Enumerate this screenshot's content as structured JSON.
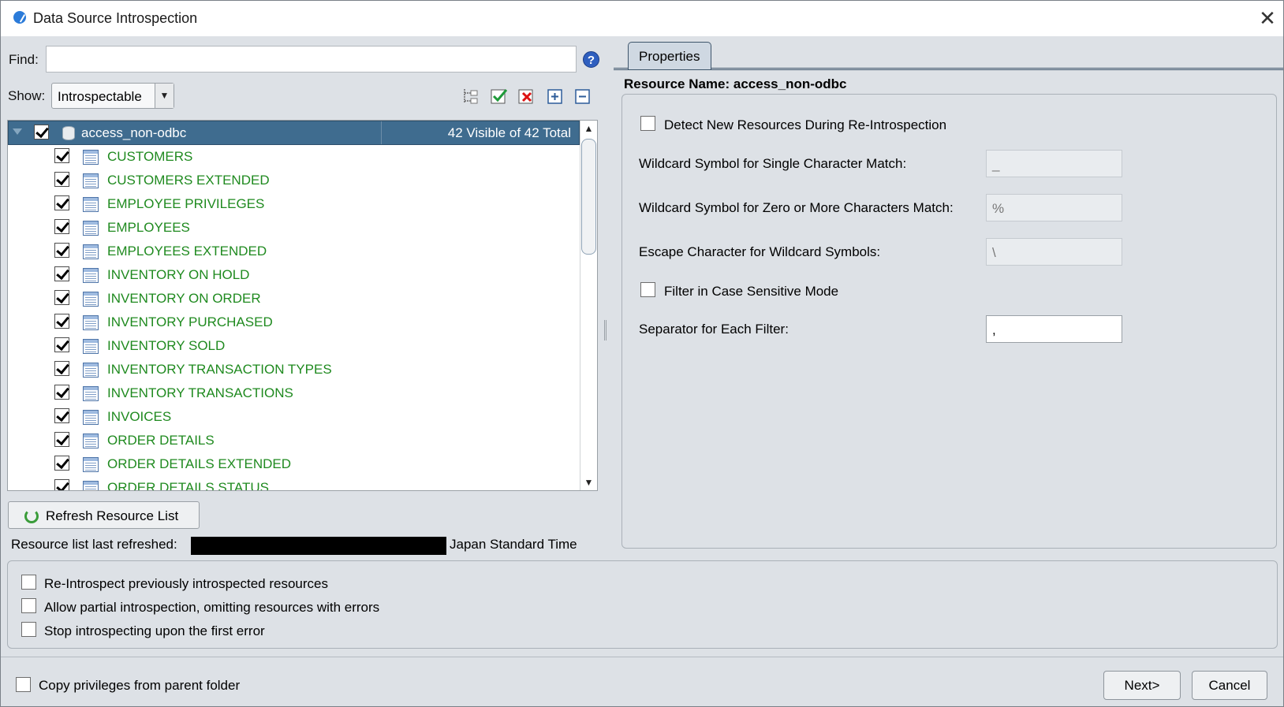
{
  "window": {
    "title": "Data Source Introspection",
    "close_glyph": "✕"
  },
  "find": {
    "label": "Find:",
    "value": "",
    "help_glyph": "?"
  },
  "show": {
    "label": "Show:",
    "selected": "Introspectable"
  },
  "tree": {
    "root": {
      "label": "access_non-odbc",
      "count": "42 Visible of 42 Total",
      "checked": true
    },
    "items": [
      {
        "label": "CUSTOMERS",
        "checked": true
      },
      {
        "label": "CUSTOMERS EXTENDED",
        "checked": true
      },
      {
        "label": "EMPLOYEE PRIVILEGES",
        "checked": true
      },
      {
        "label": "EMPLOYEES",
        "checked": true
      },
      {
        "label": "EMPLOYEES EXTENDED",
        "checked": true
      },
      {
        "label": "INVENTORY ON HOLD",
        "checked": true
      },
      {
        "label": "INVENTORY ON ORDER",
        "checked": true
      },
      {
        "label": "INVENTORY PURCHASED",
        "checked": true
      },
      {
        "label": "INVENTORY SOLD",
        "checked": true
      },
      {
        "label": "INVENTORY TRANSACTION TYPES",
        "checked": true
      },
      {
        "label": "INVENTORY TRANSACTIONS",
        "checked": true
      },
      {
        "label": "INVOICES",
        "checked": true
      },
      {
        "label": "ORDER DETAILS",
        "checked": true
      },
      {
        "label": "ORDER DETAILS EXTENDED",
        "checked": true
      },
      {
        "label": "ORDER DETAILS STATUS",
        "checked": true
      }
    ],
    "scroll_up_glyph": "▲",
    "scroll_down_glyph": "▼"
  },
  "refresh": {
    "button_label": "Refresh Resource List",
    "last_refreshed_label": "Resource list last refreshed:",
    "timezone": "Japan Standard Time"
  },
  "properties": {
    "tab_label": "Properties",
    "resource_name": "Resource Name: access_non-odbc",
    "detect_new_label": "Detect New Resources During Re-Introspection",
    "single_char_label": "Wildcard Symbol for Single Character Match:",
    "single_char_value": "_",
    "zero_more_label": "Wildcard Symbol for Zero or More Characters Match:",
    "zero_more_value": "%",
    "escape_label": "Escape Character for Wildcard Symbols:",
    "escape_value": "\\",
    "case_sensitive_label": "Filter in Case Sensitive Mode",
    "separator_label": "Separator for Each Filter:",
    "separator_value": ","
  },
  "options": {
    "reintrospect_label": "Re-Introspect previously introspected resources",
    "partial_label": "Allow partial introspection, omitting resources with errors",
    "stop_label": "Stop introspecting upon the first error"
  },
  "footer": {
    "copy_privileges_label": "Copy privileges from parent folder",
    "next_label": "Next>",
    "cancel_label": "Cancel"
  }
}
